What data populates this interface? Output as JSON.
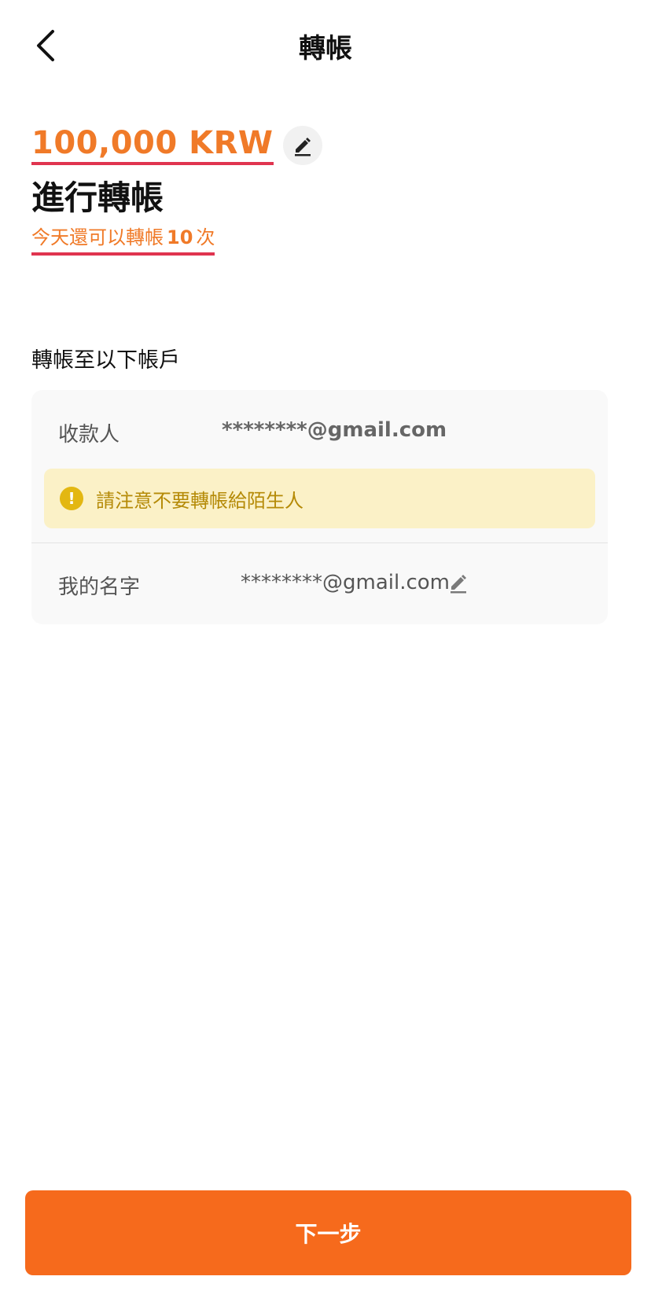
{
  "header": {
    "title": "轉帳"
  },
  "transfer": {
    "amount": "100,000 KRW",
    "action_title": "進行轉帳",
    "remaining_prefix": "今天還可以轉帳",
    "remaining_count": "10",
    "remaining_suffix": "次"
  },
  "account_section": {
    "label": "轉帳至以下帳戶",
    "payee_label": "收款人",
    "payee_value": "********@gmail.com",
    "warning_text": "請注意不要轉帳給陌生人",
    "my_name_label": "我的名字",
    "my_name_value": "********@gmail.com"
  },
  "footer": {
    "next_label": "下一步"
  },
  "colors": {
    "accent": "#f66a1c",
    "amount": "#f07a28",
    "underline": "#e0344f",
    "warning_bg": "#fbf1c7",
    "warning_icon": "#e3b712"
  },
  "icons": {
    "back": "chevron-left-icon",
    "edit_amount": "pencil-icon",
    "warning": "exclamation-circle-icon",
    "edit_name": "pencil-icon"
  }
}
